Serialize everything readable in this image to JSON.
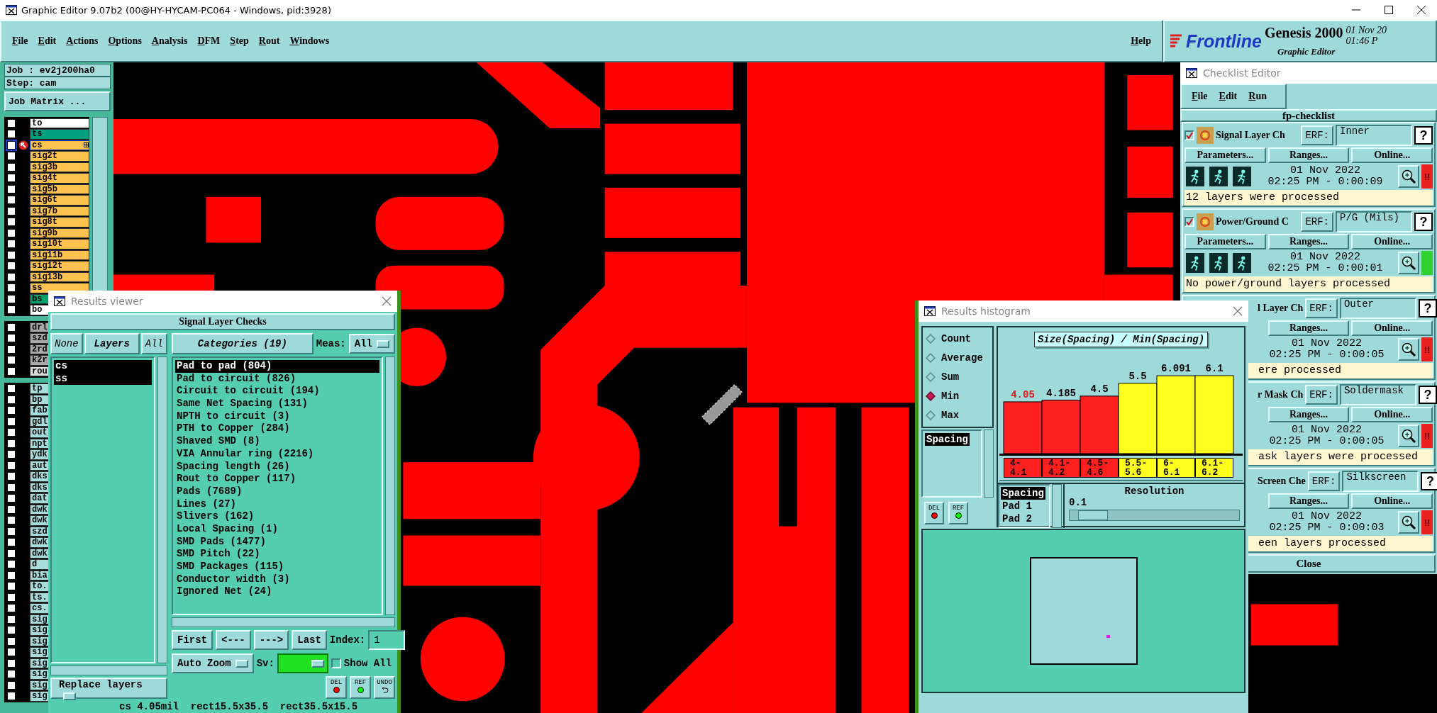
{
  "window": {
    "title": "Graphic Editor 9.07b2 (00@HY-HYCAM-PC064 - Windows, pid:3928)"
  },
  "menu": [
    "File",
    "Edit",
    "Actions",
    "Options",
    "Analysis",
    "DFM",
    "Step",
    "Rout",
    "Windows"
  ],
  "help": "Help",
  "logo": {
    "brand": "Frontline",
    "product": "Genesis 2000",
    "app": "Graphic Editor",
    "date": "01 Nov 20",
    "time": "01:46 P"
  },
  "job_panel": {
    "job": "Job : ev2j200ha0",
    "step": "Step: cam",
    "matrix_button": "Job Matrix ...",
    "layer_groups": [
      [
        {
          "name": "to",
          "color": "#ffffff",
          "checked": false,
          "selected": false
        },
        {
          "name": "ts",
          "color": "#00a07e",
          "checked": false,
          "selected": false
        },
        {
          "name": "cs",
          "color": "#ffc24e",
          "checked": false,
          "selected": true
        },
        {
          "name": "sig2t",
          "color": "#ffc24e",
          "checked": false,
          "selected": false
        },
        {
          "name": "sig3b",
          "color": "#ffc24e",
          "checked": false,
          "selected": false
        },
        {
          "name": "sig4t",
          "color": "#ffc24e",
          "checked": false,
          "selected": false
        },
        {
          "name": "sig5b",
          "color": "#ffc24e",
          "checked": false,
          "selected": false
        },
        {
          "name": "sig6t",
          "color": "#ffc24e",
          "checked": false,
          "selected": false
        },
        {
          "name": "sig7b",
          "color": "#ffc24e",
          "checked": false,
          "selected": false
        },
        {
          "name": "sig8t",
          "color": "#ffc24e",
          "checked": false,
          "selected": false
        },
        {
          "name": "sig9b",
          "color": "#ffc24e",
          "checked": false,
          "selected": false
        },
        {
          "name": "sig10t",
          "color": "#ffc24e",
          "checked": false,
          "selected": false
        },
        {
          "name": "sig11b",
          "color": "#ffc24e",
          "checked": false,
          "selected": false
        },
        {
          "name": "sig12t",
          "color": "#ffc24e",
          "checked": false,
          "selected": false
        },
        {
          "name": "sig13b",
          "color": "#ffc24e",
          "checked": false,
          "selected": false
        },
        {
          "name": "ss",
          "color": "#ffc24e",
          "checked": false,
          "selected": false
        },
        {
          "name": "bs",
          "color": "#00a06a",
          "checked": false,
          "selected": false
        },
        {
          "name": "bo",
          "color": "#ffffff",
          "checked": false,
          "selected": false
        }
      ],
      [
        {
          "name": "drl",
          "color": "#a9a9a9",
          "checked": false,
          "selected": false
        },
        {
          "name": "szd",
          "color": "#a9a9a9",
          "checked": false,
          "selected": false
        },
        {
          "name": "2rd",
          "color": "#a9a9a9",
          "checked": false,
          "selected": false
        },
        {
          "name": "k2r",
          "color": "#a9a9a9",
          "checked": false,
          "selected": false
        },
        {
          "name": "rou",
          "color": "#dcdcdc",
          "checked": false,
          "selected": false
        }
      ],
      [
        {
          "name": "tp",
          "color": "#a6dcdc",
          "checked": false,
          "selected": false
        },
        {
          "name": "bp",
          "color": "#a6dcdc",
          "checked": false,
          "selected": false
        },
        {
          "name": "fab",
          "color": "#a6dcdc",
          "checked": false,
          "selected": false
        },
        {
          "name": "gdl",
          "color": "#a6dcdc",
          "checked": false,
          "selected": false
        },
        {
          "name": "out",
          "color": "#a6dcdc",
          "checked": false,
          "selected": false
        },
        {
          "name": "npt",
          "color": "#a6dcdc",
          "checked": false,
          "selected": false
        },
        {
          "name": "ydk",
          "color": "#a6dcdc",
          "checked": false,
          "selected": false
        },
        {
          "name": "aut",
          "color": "#a6dcdc",
          "checked": false,
          "selected": false
        },
        {
          "name": "dks",
          "color": "#a6dcdc",
          "checked": false,
          "selected": false
        },
        {
          "name": "dks",
          "color": "#a6dcdc",
          "checked": false,
          "selected": false
        },
        {
          "name": "dat",
          "color": "#a6dcdc",
          "checked": false,
          "selected": false
        },
        {
          "name": "dwk",
          "color": "#a6dcdc",
          "checked": false,
          "selected": false
        },
        {
          "name": "dwk",
          "color": "#a6dcdc",
          "checked": false,
          "selected": false
        },
        {
          "name": "szd",
          "color": "#a6dcdc",
          "checked": false,
          "selected": false
        },
        {
          "name": "dwk",
          "color": "#a6dcdc",
          "checked": false,
          "selected": false
        },
        {
          "name": "dwk",
          "color": "#a6dcdc",
          "checked": false,
          "selected": false
        },
        {
          "name": "d",
          "color": "#a6dcdc",
          "checked": false,
          "selected": false
        },
        {
          "name": "bia",
          "color": "#a6dcdc",
          "checked": false,
          "selected": false
        },
        {
          "name": "to.",
          "color": "#a6dcdc",
          "checked": false,
          "selected": false
        },
        {
          "name": "ts.",
          "color": "#a6dcdc",
          "checked": false,
          "selected": false
        },
        {
          "name": "cs.",
          "color": "#a6dcdc",
          "checked": false,
          "selected": false
        },
        {
          "name": "sig",
          "color": "#a6dcdc",
          "checked": false,
          "selected": false
        },
        {
          "name": "sig",
          "color": "#a6dcdc",
          "checked": false,
          "selected": false
        },
        {
          "name": "sig",
          "color": "#a6dcdc",
          "checked": false,
          "selected": false
        },
        {
          "name": "sig",
          "color": "#a6dcdc",
          "checked": false,
          "selected": false
        },
        {
          "name": "sig",
          "color": "#a6dcdc",
          "checked": false,
          "selected": false
        },
        {
          "name": "sig",
          "color": "#a6dcdc",
          "checked": false,
          "selected": false
        },
        {
          "name": "sig",
          "color": "#a6dcdc",
          "checked": false,
          "selected": false
        },
        {
          "name": "sig",
          "color": "#a6dcdc",
          "checked": false,
          "selected": false
        }
      ]
    ]
  },
  "results_viewer": {
    "title": "Results viewer",
    "heading": "Signal Layer Checks",
    "layer_buttons": [
      "None",
      "Layers",
      "All"
    ],
    "layers": [
      {
        "name": "cs",
        "selected": true
      },
      {
        "name": "ss",
        "selected": true
      }
    ],
    "categories_button": "Categories (19)",
    "meas_label": "Meas:",
    "meas_value": "All",
    "categories": [
      {
        "label": "Pad to pad (804)",
        "selected": true
      },
      {
        "label": "Pad to circuit (826)",
        "selected": false
      },
      {
        "label": "Circuit to circuit (194)",
        "selected": false
      },
      {
        "label": "Same Net Spacing (131)",
        "selected": false
      },
      {
        "label": "NPTH to circuit (3)",
        "selected": false
      },
      {
        "label": "PTH to Copper (284)",
        "selected": false
      },
      {
        "label": "Shaved SMD (8)",
        "selected": false
      },
      {
        "label": "VIA Annular ring (2216)",
        "selected": false
      },
      {
        "label": "Spacing length (26)",
        "selected": false
      },
      {
        "label": "Rout to Copper (117)",
        "selected": false
      },
      {
        "label": "Pads (7689)",
        "selected": false
      },
      {
        "label": "Lines (27)",
        "selected": false
      },
      {
        "label": "Slivers (162)",
        "selected": false
      },
      {
        "label": "Local Spacing (1)",
        "selected": false
      },
      {
        "label": "SMD Pads (1477)",
        "selected": false
      },
      {
        "label": "SMD Pitch (22)",
        "selected": false
      },
      {
        "label": "SMD Packages (115)",
        "selected": false
      },
      {
        "label": "Conductor width (3)",
        "selected": false
      },
      {
        "label": "Ignored Net (24)",
        "selected": false
      }
    ],
    "nav_buttons": [
      "First",
      "<---",
      "--->",
      "Last"
    ],
    "index_label": "Index:",
    "index_value": "1",
    "zoom_mode": "Auto Zoom",
    "sv_label": "Sv:",
    "sv": {
      "color": "#22e022"
    },
    "show_all": {
      "label": "Show All",
      "checked": false
    },
    "replace_mode": "Replace layers",
    "action_buttons": [
      "DEL",
      "REF",
      "UNDO"
    ],
    "status": "cs 4.05mil  rect15.5x35.5  rect35.5x15.5"
  },
  "histogram": {
    "title": "Results histogram",
    "modes": [
      {
        "label": "Count",
        "selected": false
      },
      {
        "label": "Average",
        "selected": false
      },
      {
        "label": "Sum",
        "selected": false
      },
      {
        "label": "Min",
        "selected": true
      },
      {
        "label": "Max",
        "selected": false
      }
    ],
    "measures": [
      {
        "label": "Spacing",
        "selected": true
      }
    ],
    "chart_data": {
      "type": "bar",
      "title": "Size(Spacing) / Min(Spacing)",
      "categories": [
        "4-4.1",
        "4.1-4.2",
        "4.5-4.6",
        "5.5-5.6",
        "6-6.1",
        "6.1-6.2"
      ],
      "series": [
        {
          "color": "#ff1f1f",
          "values": [
            4.05,
            4.185,
            4.5,
            null,
            null,
            null
          ]
        },
        {
          "color": "#ffff1f",
          "values": [
            null,
            null,
            null,
            5.5,
            6.091,
            6.1
          ]
        }
      ],
      "stacked": true,
      "data_labels": true
    },
    "fields": [
      {
        "label": "Spacing",
        "selected": true
      },
      {
        "label": "Pad 1",
        "selected": false
      },
      {
        "label": "Pad 2",
        "selected": false
      }
    ],
    "resolution_label": "Resolution",
    "resolution_value": "0.1",
    "resolution": {
      "level": 0.05
    },
    "buttons": [
      "DEL",
      "REF"
    ]
  },
  "checklist": {
    "title": "Checklist Editor",
    "menu": [
      "File",
      "Edit",
      "Run"
    ],
    "name": "fp-checklist",
    "checks": [
      {
        "checked": true,
        "name": "Signal Layer Ch",
        "erf_label": "ERF:",
        "erf": "Inner",
        "help": "?",
        "buttons": [
          "Parameters...",
          "Ranges...",
          "Online..."
        ],
        "date": "01 Nov 2022",
        "time": "02:25 PM - 0:00:09",
        "color": "#e82020",
        "status_mark": "!!",
        "message": "12 layers were processed"
      },
      {
        "checked": true,
        "name": "Power/Ground C",
        "erf_label": "ERF:",
        "erf": "P/G (Mils)",
        "help": "?",
        "buttons": [
          "Parameters...",
          "Ranges...",
          "Online..."
        ],
        "date": "01 Nov 2022",
        "time": "02:25 PM - 0:00:01",
        "color": "#30d030",
        "message": "No power/ground layers processed"
      },
      {
        "name": "l Layer Ch",
        "erf_label": "ERF:",
        "erf": "Outer",
        "help": "?",
        "buttons": [
          "Ranges...",
          "Online..."
        ],
        "date": "01 Nov 2022",
        "time": "02:25 PM - 0:00:05",
        "color": "#e82020",
        "status_mark": "!!",
        "message": "ere processed"
      },
      {
        "name": "r Mask Ch",
        "erf_label": "ERF:",
        "erf": "Soldermask",
        "help": "?",
        "buttons": [
          "Ranges...",
          "Online..."
        ],
        "date": "01 Nov 2022",
        "time": "02:25 PM - 0:00:05",
        "color": "#e82020",
        "status_mark": "!!",
        "message": "ask layers were processed"
      },
      {
        "name": "Screen Che",
        "erf_label": "ERF:",
        "erf": "Silkscreen",
        "help": "?",
        "buttons": [
          "Ranges...",
          "Online..."
        ],
        "date": "01 Nov 2022",
        "time": "02:25 PM - 0:00:03",
        "color": "#e82020",
        "status_mark": "!!",
        "message": "een layers processed"
      }
    ],
    "close": "Close"
  }
}
